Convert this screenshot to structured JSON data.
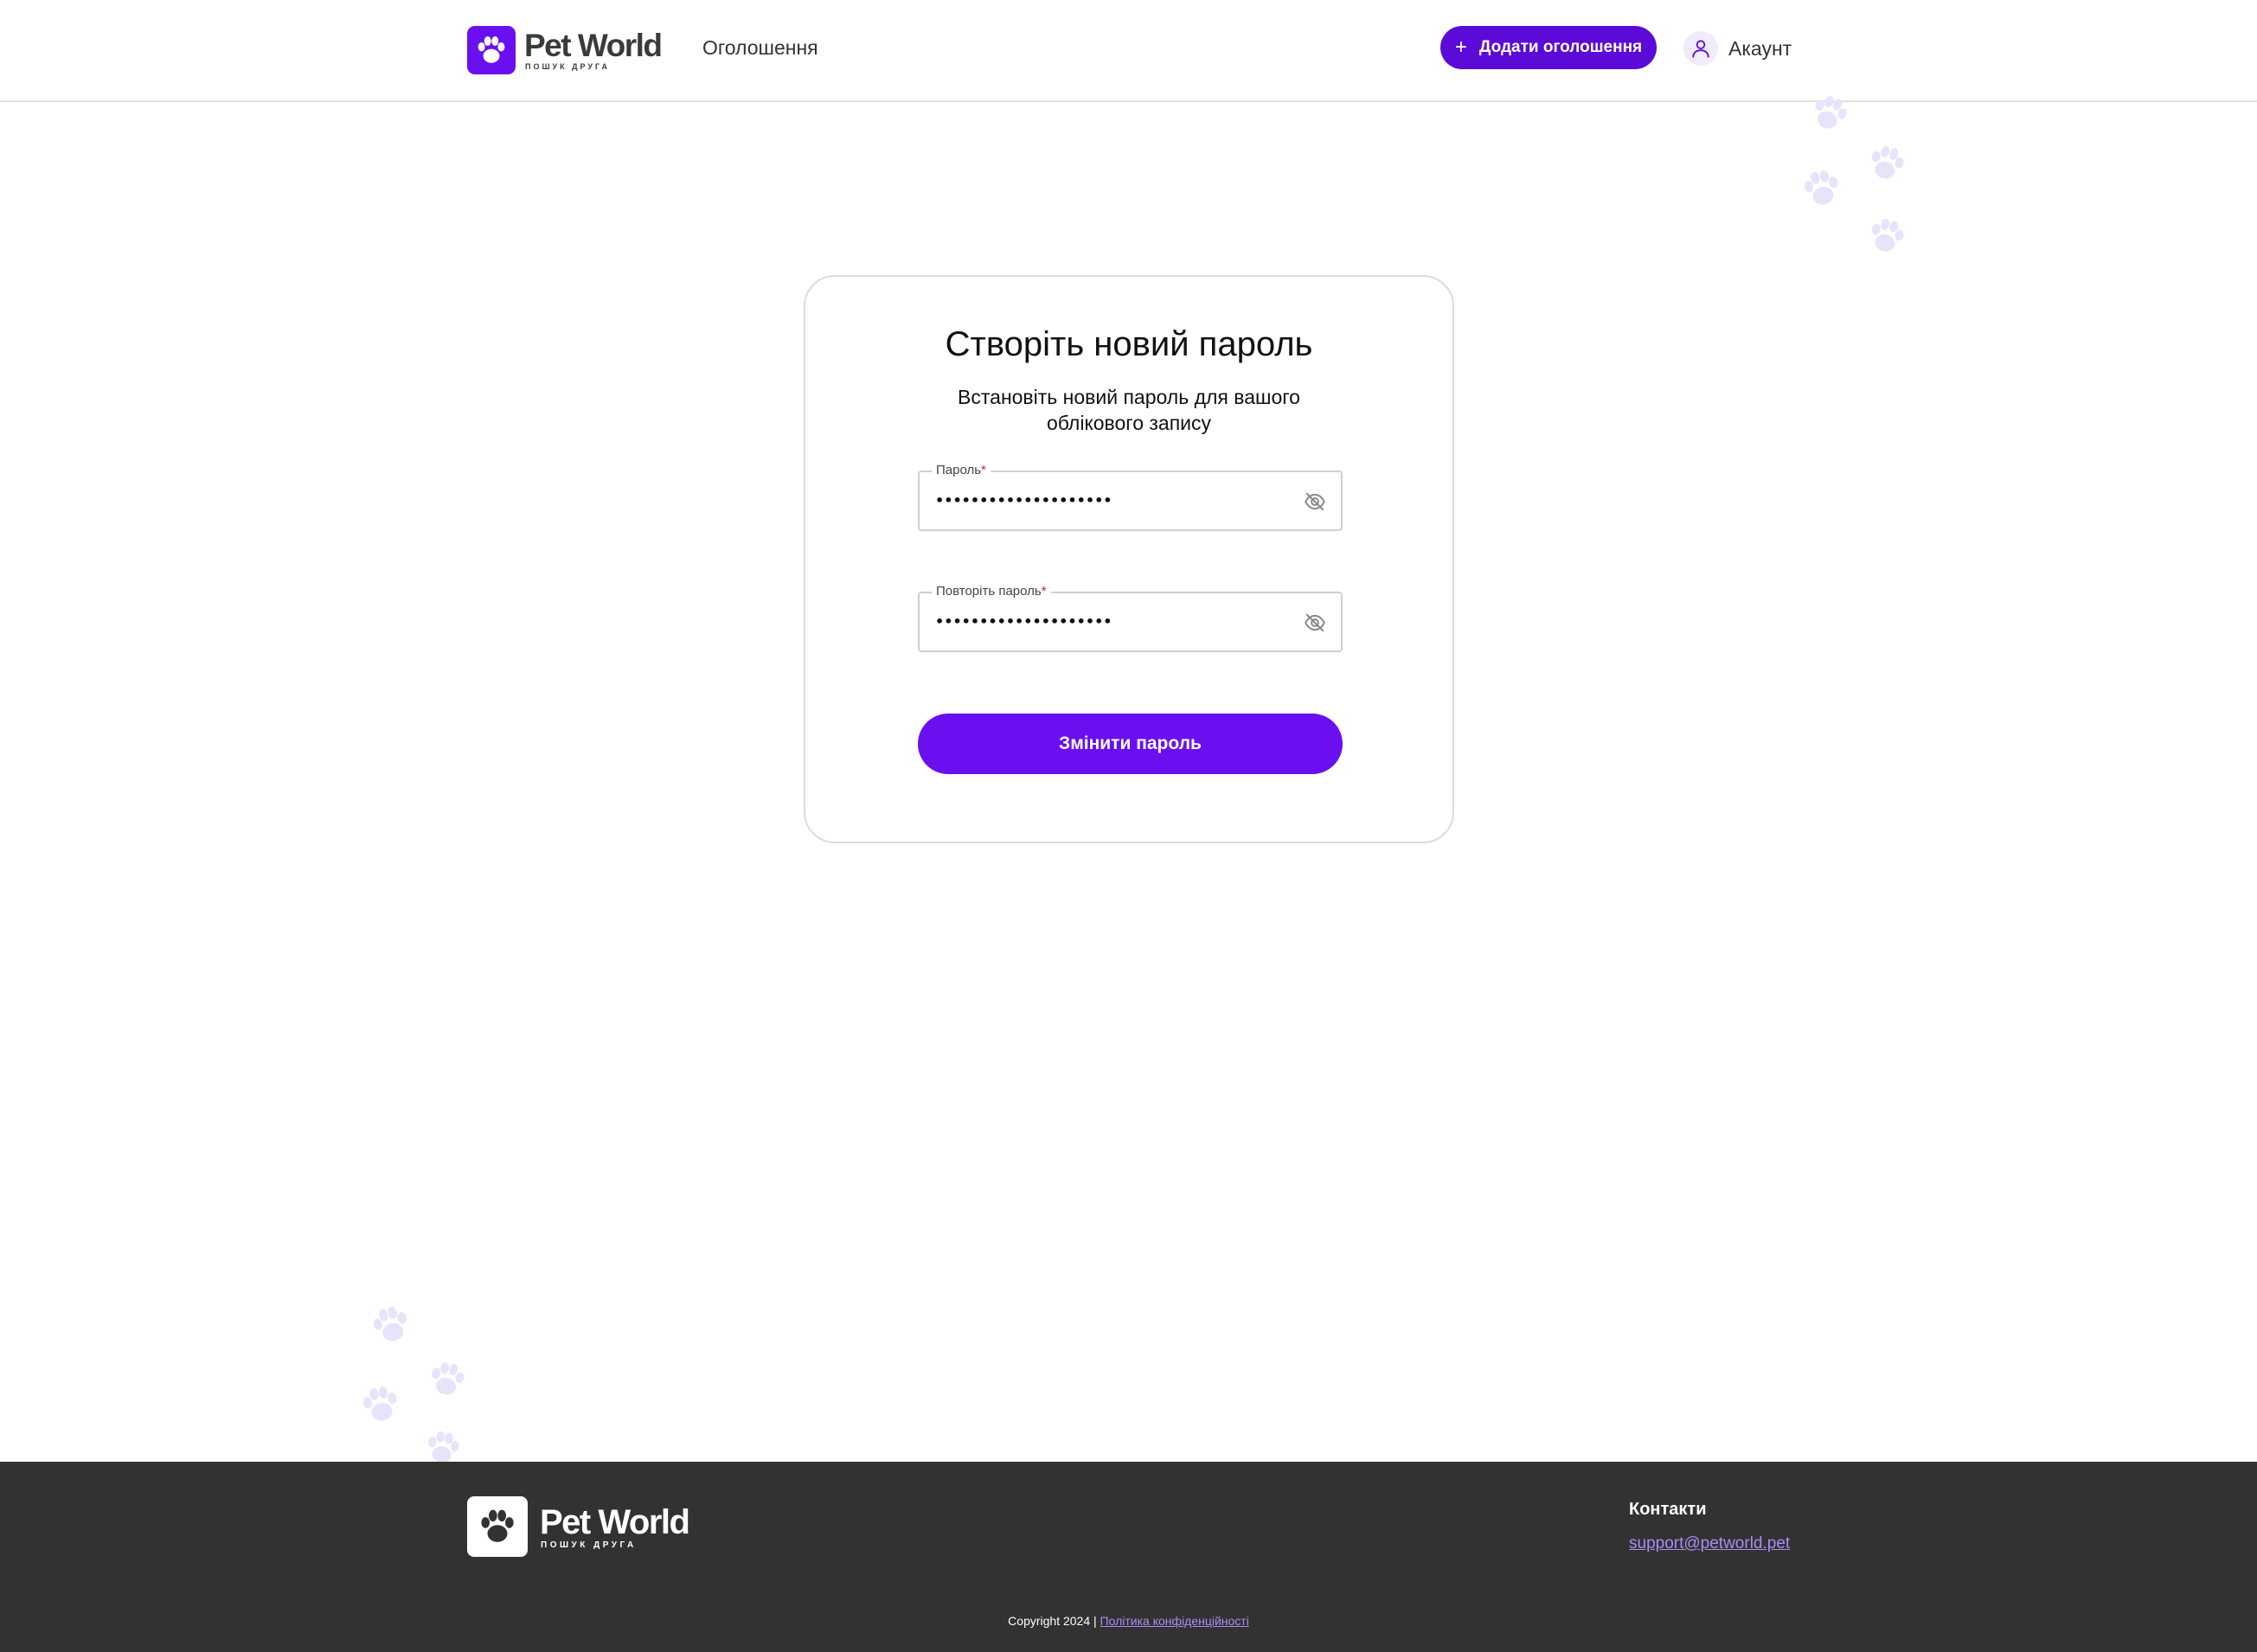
{
  "header": {
    "logo": {
      "name": "Pet World",
      "tagline": "ПОШУК ДРУГА"
    },
    "nav_ads": "Оголошення",
    "add_button": {
      "plus": "+",
      "label": "Додати оголошення"
    },
    "account_label": "Акаунт"
  },
  "card": {
    "title": "Створіть новий пароль",
    "subtitle": "Встановіть новий пароль для вашого облікового запису",
    "password": {
      "label": "Пароль",
      "required_mark": "*",
      "value": "••••••••••••••••••••",
      "toggle_icon": "eye-off-icon"
    },
    "repeat_password": {
      "label": "Повторіть пароль",
      "required_mark": "*",
      "value": "••••••••••••••••••••",
      "toggle_icon": "eye-off-icon"
    },
    "submit_label": "Змінити пароль"
  },
  "footer": {
    "logo": {
      "name": "Pet World",
      "tagline": "ПОШУК ДРУГА"
    },
    "contacts_title": "Контакти",
    "email": "support@petworld.pet",
    "copyright": "Copyright 2024 |",
    "privacy_link": "Політика конфіденційності"
  },
  "colors": {
    "brand_purple": "#6a0ff0",
    "button_purple": "#5b0ad8",
    "footer_bg": "#323232",
    "link_purple": "#a98cf4",
    "paw_lavender": "#e9e2fb"
  }
}
